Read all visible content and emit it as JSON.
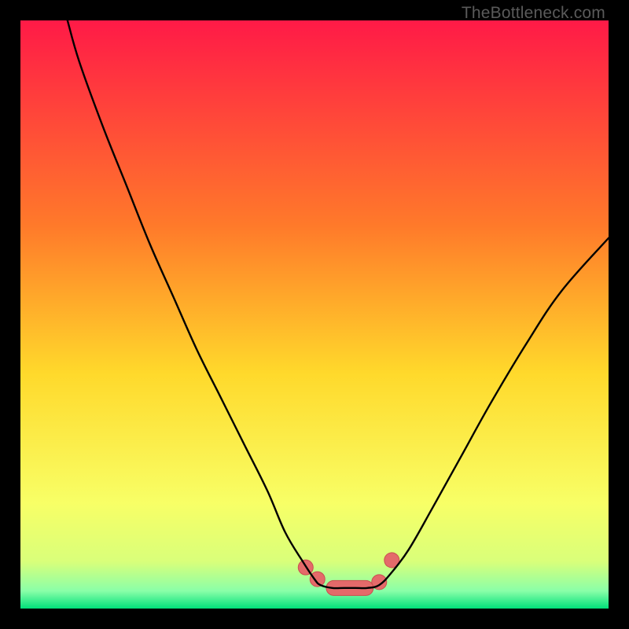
{
  "watermark": {
    "text": "TheBottleneck.com"
  },
  "colors": {
    "black": "#000000",
    "grad_top": "#ff1a47",
    "grad_mid1": "#ff7a2a",
    "grad_mid2": "#ffd92b",
    "grad_mid3": "#f8ff66",
    "grad_low1": "#d9ff7a",
    "grad_low2": "#8affa8",
    "grad_bottom": "#00e07a",
    "curve": "#000000",
    "marker_fill": "#e46a6a",
    "marker_stroke": "#c94f4f"
  },
  "chart_data": {
    "type": "line",
    "title": "",
    "xlabel": "",
    "ylabel": "",
    "xlim": [
      0,
      100
    ],
    "ylim": [
      0,
      100
    ],
    "grid": false,
    "legend": false,
    "ticks": {
      "x": [],
      "y": []
    },
    "series": [
      {
        "name": "left-branch",
        "x": [
          8,
          10,
          14,
          18,
          22,
          26,
          30,
          34,
          38,
          42,
          45,
          48,
          50,
          51
        ],
        "y": [
          100,
          93,
          82,
          72,
          62,
          53,
          44,
          36,
          28,
          20,
          13,
          8,
          5,
          4
        ]
      },
      {
        "name": "plateau",
        "x": [
          51,
          53,
          55,
          57,
          59,
          61
        ],
        "y": [
          4,
          3.5,
          3.5,
          3.5,
          3.5,
          4
        ]
      },
      {
        "name": "right-branch",
        "x": [
          61,
          63,
          66,
          70,
          75,
          80,
          86,
          92,
          100
        ],
        "y": [
          4,
          6,
          10,
          17,
          26,
          35,
          45,
          54,
          63
        ]
      }
    ],
    "markers": [
      {
        "type": "dot",
        "x": 48.5,
        "y": 7.0
      },
      {
        "type": "dot",
        "x": 50.5,
        "y": 5.0
      },
      {
        "type": "dot",
        "x": 61.0,
        "y": 4.5
      },
      {
        "type": "pill",
        "x0": 52.0,
        "x1": 60.0,
        "y": 3.5
      },
      {
        "type": "pill",
        "x0": 62.0,
        "x1": 64.0,
        "y": 8.0,
        "tilt": -58
      }
    ]
  }
}
